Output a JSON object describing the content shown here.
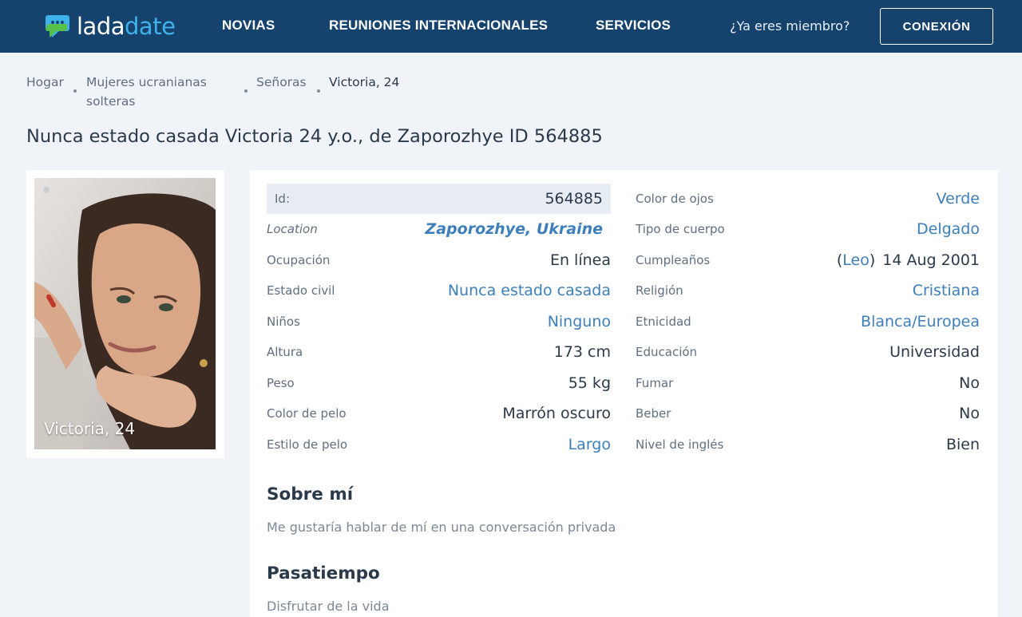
{
  "header": {
    "logo_part1": "lada",
    "logo_part2": "date",
    "nav": [
      "NOVIAS",
      "REUNIONES INTERNACIONALES",
      "SERVICIOS"
    ],
    "member_text": "¿Ya eres miembro?",
    "login_label": "CONEXIÓN"
  },
  "breadcrumb": {
    "home": "Hogar",
    "cat_line1": "Mujeres ucranianas",
    "cat_line2": "solteras",
    "ladies": "Señoras",
    "current": "Victoria, 24"
  },
  "title": "Nunca estado casada Victoria 24 y.o., de Zaporozhye ID 564885",
  "photo": {
    "caption": "Victoria, 24"
  },
  "profile_left": [
    {
      "label": "Id:",
      "value": "564885"
    },
    {
      "label": "Location",
      "value": "Zaporozhye, Ukraine"
    },
    {
      "label": "Ocupación",
      "value": "En línea"
    },
    {
      "label": "Estado civil",
      "value": "Nunca estado casada"
    },
    {
      "label": "Niños",
      "value": "Ninguno"
    },
    {
      "label": "Altura",
      "value": "173 cm"
    },
    {
      "label": "Peso",
      "value": "55 kg"
    },
    {
      "label": "Color de pelo",
      "value": "Marrón oscuro"
    },
    {
      "label": "Estilo de pelo",
      "value": "Largo"
    }
  ],
  "profile_right": [
    {
      "label": "Color de ojos",
      "value": "Verde"
    },
    {
      "label": "Tipo de cuerpo",
      "value": "Delgado"
    },
    {
      "label": "Cumpleaños",
      "zodiac": "Leo",
      "value": "14 Aug 2001"
    },
    {
      "label": "Religión",
      "value": "Cristiana"
    },
    {
      "label": "Etnicidad",
      "value": "Blanca/Europea"
    },
    {
      "label": "Educación",
      "value": "Universidad"
    },
    {
      "label": "Fumar",
      "value": "No"
    },
    {
      "label": "Beber",
      "value": "No"
    },
    {
      "label": "Nivel de inglés",
      "value": "Bien"
    }
  ],
  "about": {
    "heading": "Sobre mí",
    "text": "Me gustaría hablar de mí en una conversación privada"
  },
  "hobby": {
    "heading": "Pasatiempo",
    "text": "Disfrutar de la vida"
  },
  "colors": {
    "header_bg": "#15436d",
    "accent": "#3fb2ec",
    "link": "#3d7fba"
  }
}
